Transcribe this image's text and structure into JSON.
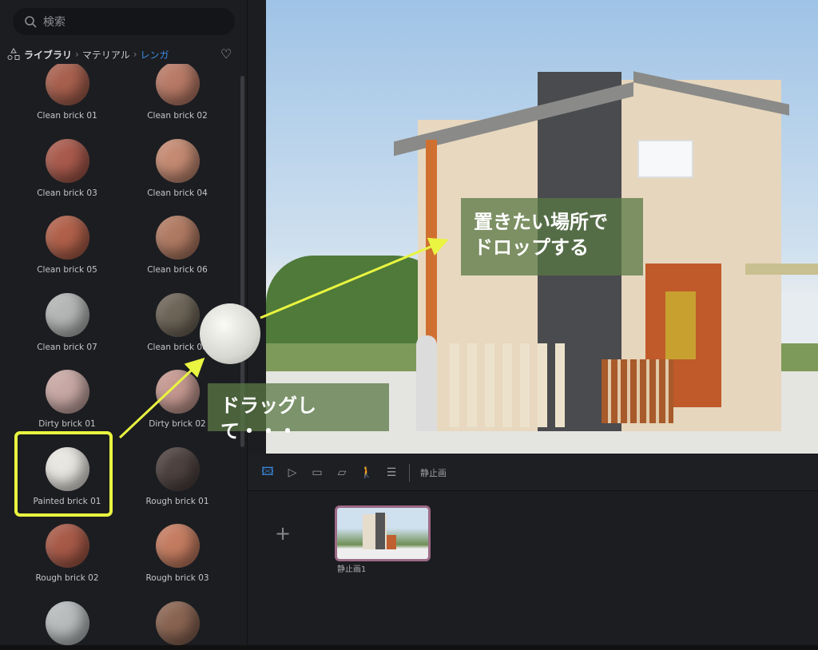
{
  "sidebar": {
    "search_placeholder": "検索",
    "breadcrumb": [
      "ライブラリ",
      "マテリアル",
      "レンガ"
    ],
    "items": [
      {
        "label": "Clean brick 01",
        "color": "#a8604e"
      },
      {
        "label": "Clean brick 02",
        "color": "#b87a66"
      },
      {
        "label": "Clean brick 03",
        "color": "#a85a4c"
      },
      {
        "label": "Clean brick 04",
        "color": "#c48a72"
      },
      {
        "label": "Clean brick 05",
        "color": "#b0604a"
      },
      {
        "label": "Clean brick 06",
        "color": "#b07a62"
      },
      {
        "label": "Clean brick 07",
        "color": "#b4b6b6"
      },
      {
        "label": "Clean brick 08",
        "color": "#6e6558"
      },
      {
        "label": "Dirty brick 01",
        "color": "#c8a8a4"
      },
      {
        "label": "Dirty brick 02",
        "color": "#c49890"
      },
      {
        "label": "Painted brick 01",
        "color": "#e8e6e0"
      },
      {
        "label": "Rough brick 01",
        "color": "#4e4240"
      },
      {
        "label": "Rough brick 02",
        "color": "#a85a48"
      },
      {
        "label": "Rough brick 03",
        "color": "#c47c60"
      },
      {
        "label": "",
        "color": "#b8bcbd"
      },
      {
        "label": "",
        "color": "#8a6452"
      }
    ]
  },
  "toolbar": {
    "icons": [
      "image-icon",
      "video-icon",
      "panorama-icon",
      "layers-icon",
      "walk-icon",
      "stack-icon"
    ],
    "mode_label": "静止画",
    "active_color": "#3a8ee6"
  },
  "timeline": {
    "add": "+",
    "thumbnails": [
      {
        "label": "静止画1"
      }
    ]
  },
  "annotations": {
    "drop": "置きたい場所で\nドロップする",
    "drag": "ドラッグして・・・",
    "highlight_color": "#e9f540"
  }
}
